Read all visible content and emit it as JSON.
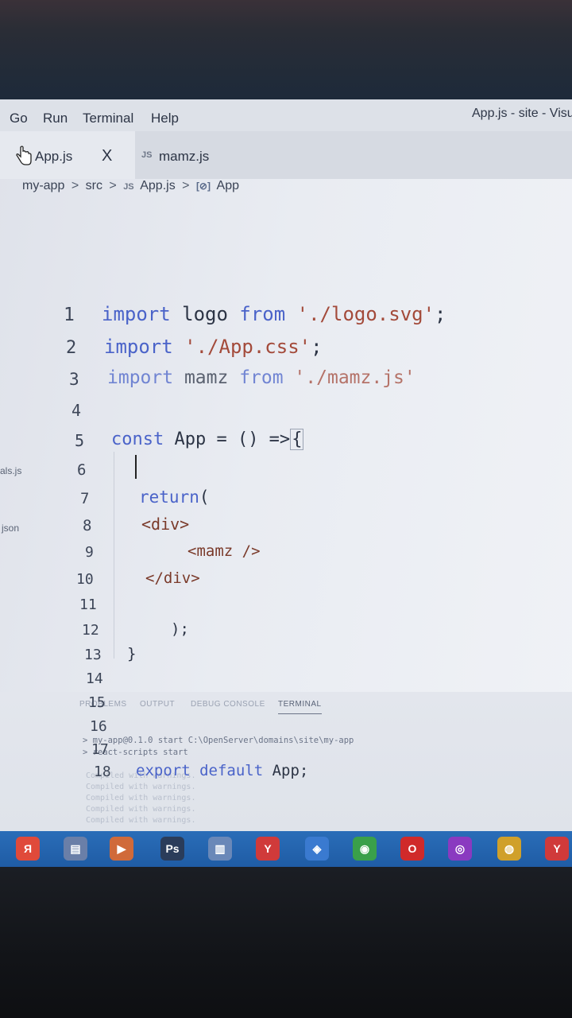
{
  "menubar": {
    "items": [
      "Go",
      "Run",
      "Terminal",
      "Help"
    ],
    "window_title": "App.js - site - Visu"
  },
  "tabs": [
    {
      "label": "App.js",
      "badge": "",
      "active": true
    },
    {
      "label": "mamz.js",
      "badge": "JS",
      "active": false
    }
  ],
  "tab_close": "X",
  "breadcrumb": {
    "parts": [
      "my-app",
      ">",
      "src",
      ">",
      "JS",
      "App.js",
      ">",
      "[⊘]",
      "App"
    ]
  },
  "editor": {
    "lines": [
      {
        "n": "1",
        "code": "import logo from './logo.svg';"
      },
      {
        "n": "2",
        "code": "import './App.css';"
      },
      {
        "n": "3",
        "code": "import mamz from './mamz.js'"
      },
      {
        "n": "4",
        "code": ""
      },
      {
        "n": "5",
        "code": "const App = () =>{"
      },
      {
        "n": "6",
        "code": ""
      },
      {
        "n": "7",
        "code": "return("
      },
      {
        "n": "8",
        "code": "<div>"
      },
      {
        "n": "9",
        "code": "<mamz />"
      },
      {
        "n": "10",
        "code": "</div>"
      },
      {
        "n": "11",
        "code": ""
      },
      {
        "n": "12",
        "code": ");"
      },
      {
        "n": "13",
        "code": "}"
      },
      {
        "n": "14",
        "code": ""
      },
      {
        "n": "15",
        "code": ""
      },
      {
        "n": "16",
        "code": ""
      },
      {
        "n": "17",
        "code": ""
      },
      {
        "n": "18",
        "code": "export default App;"
      }
    ]
  },
  "explorer_fragments": [
    "als.js",
    "json"
  ],
  "panel": {
    "tabs": [
      "PROBLEMS",
      "OUTPUT",
      "DEBUG CONSOLE",
      "TERMINAL"
    ],
    "active_tab": "TERMINAL",
    "terminal_lines": [
      "> my-app@0.1.0 start C:\\OpenServer\\domains\\site\\my-app",
      "> react-scripts start"
    ],
    "faded_lines": [
      "Compiled with warnings.",
      "Compiled with warnings.",
      "Compiled with warnings.",
      "Compiled with warnings.",
      "Compiled with warnings."
    ]
  },
  "taskbar": {
    "icons": [
      {
        "name": "yandex-icon",
        "glyph": "Я",
        "color": "#e04a3a"
      },
      {
        "name": "file-explorer-icon",
        "glyph": "▤",
        "color": "#6a7fa8"
      },
      {
        "name": "media-player-icon",
        "glyph": "▶",
        "color": "#d06a3a"
      },
      {
        "name": "photoshop-icon",
        "glyph": "Ps",
        "color": "#2a3c5a"
      },
      {
        "name": "folder-icon",
        "glyph": "▥",
        "color": "#6a88b8"
      },
      {
        "name": "yandex-browser-icon",
        "glyph": "Y",
        "color": "#d03a3a"
      },
      {
        "name": "vscode-icon",
        "glyph": "◈",
        "color": "#3a7ad0"
      },
      {
        "name": "cleaner-icon",
        "glyph": "◉",
        "color": "#3aa04a"
      },
      {
        "name": "opera-icon",
        "glyph": "O",
        "color": "#d02a2a"
      },
      {
        "name": "tor-icon",
        "glyph": "◎",
        "color": "#8a3ac0"
      },
      {
        "name": "chrome-icon",
        "glyph": "◍",
        "color": "#d0a02a"
      },
      {
        "name": "yandex-icon-2",
        "glyph": "Y",
        "color": "#d03a3a"
      }
    ]
  }
}
